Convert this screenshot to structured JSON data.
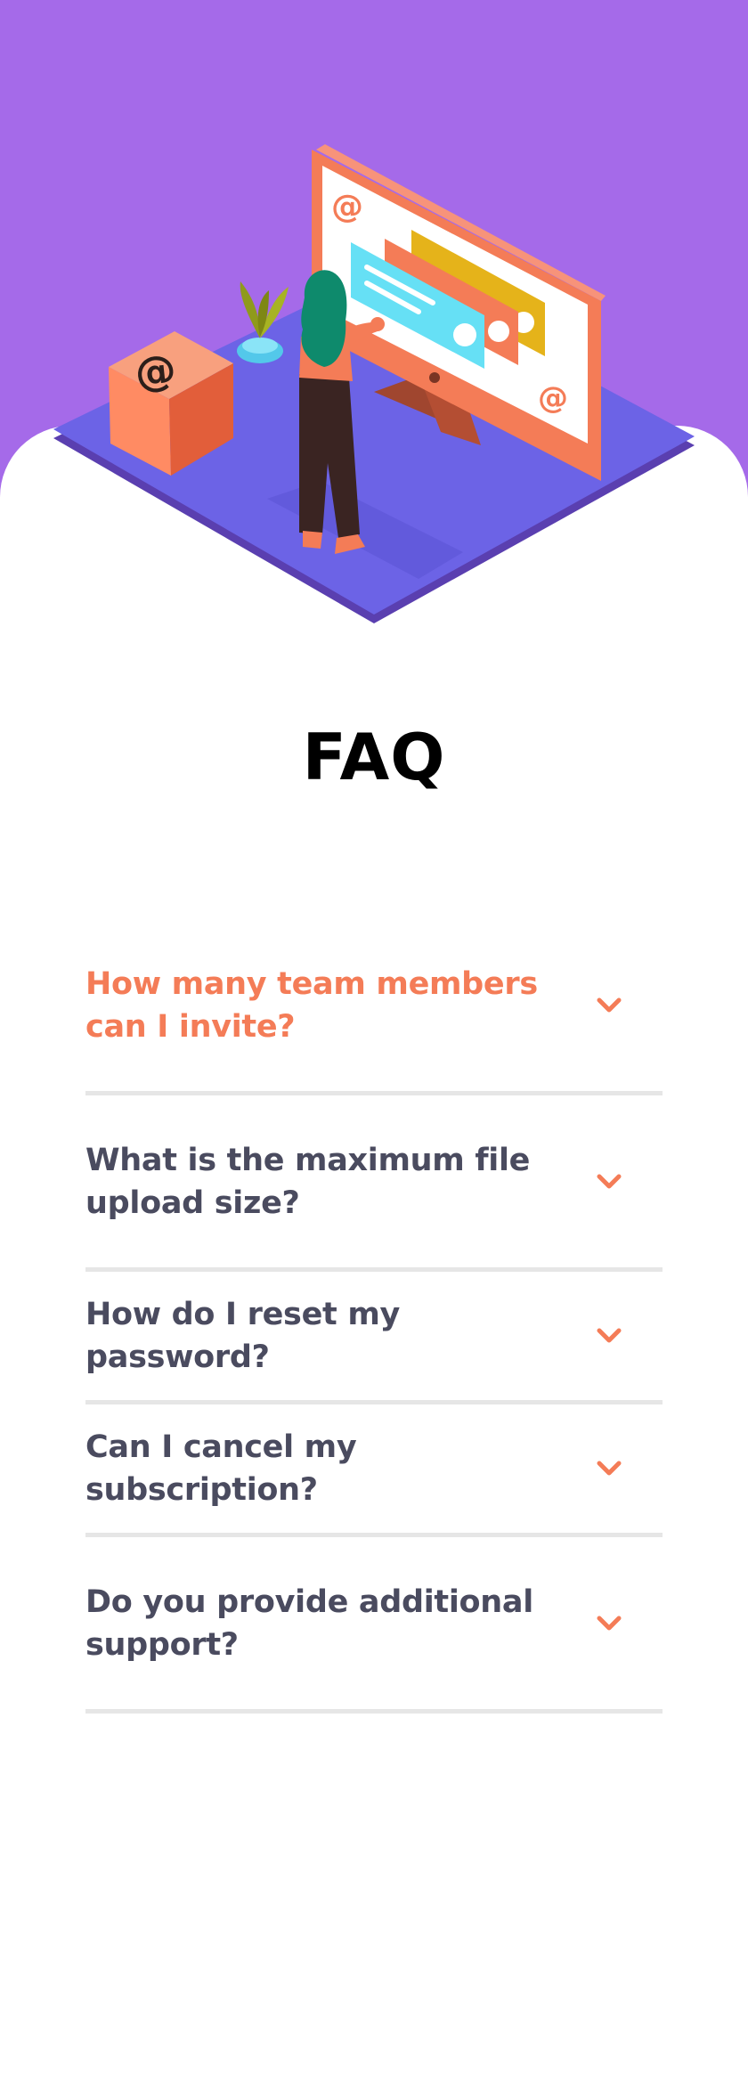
{
  "faq": {
    "title": "FAQ",
    "items": [
      {
        "question": "How many team members can I invite?",
        "active": true
      },
      {
        "question": "What is the maximum file upload size?",
        "active": false
      },
      {
        "question": "How do I reset my password?",
        "active": false
      },
      {
        "question": "Can I cancel my subscription?",
        "active": false
      },
      {
        "question": "Do you provide additional support?",
        "active": false
      }
    ]
  },
  "colors": {
    "hero_purple": "#a56ae9",
    "accent_orange": "#f47c57",
    "question_text": "#4a4b5f",
    "divider": "#e6e6e6"
  },
  "icons": {
    "toggle": "chevron-down-icon"
  }
}
